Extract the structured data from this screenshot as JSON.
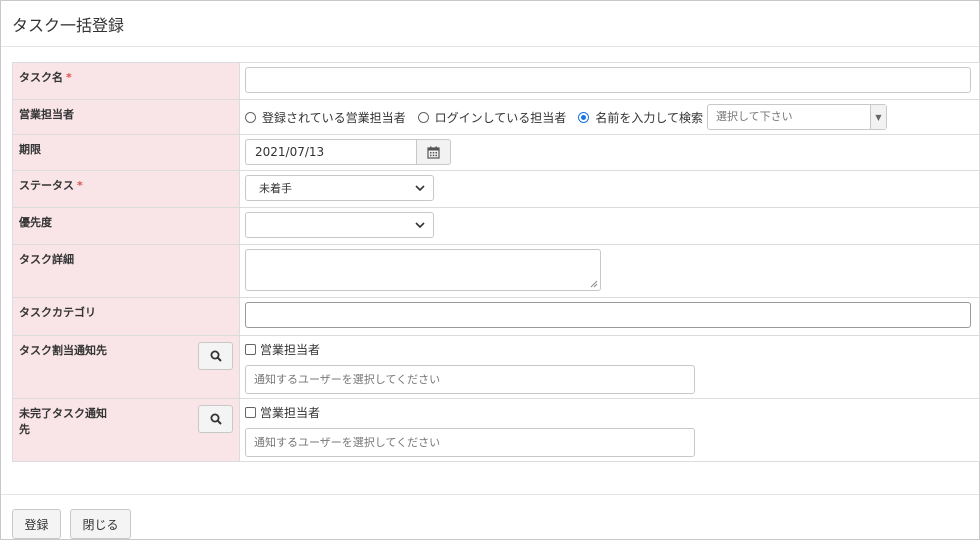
{
  "dialog": {
    "title": "タスク一括登録"
  },
  "fields": {
    "task_name": {
      "label": "タスク名",
      "required_mark": "*",
      "value": ""
    },
    "sales_owner": {
      "label": "営業担当者",
      "options": [
        {
          "label": "登録されている営業担当者",
          "selected": false
        },
        {
          "label": "ログインしている担当者",
          "selected": false
        },
        {
          "label": "名前を入力して検索",
          "selected": true
        }
      ],
      "search_placeholder": "選択して下さい",
      "dropdown_arrow": "▼"
    },
    "due_date": {
      "label": "期限",
      "value": "2021/07/13",
      "icon": "calendar-icon"
    },
    "status": {
      "label": "ステータス",
      "required_mark": "*",
      "value": "未着手"
    },
    "priority": {
      "label": "優先度",
      "value": ""
    },
    "task_detail": {
      "label": "タスク詳細",
      "value": ""
    },
    "task_category": {
      "label": "タスクカテゴリ",
      "value": ""
    },
    "assign_notify": {
      "label": "タスク割当通知先",
      "checkbox_label": "営業担当者",
      "checked": false,
      "placeholder": "通知するユーザーを選択してください",
      "icon": "search-icon"
    },
    "incomplete_notify": {
      "label_line1": "未完了タスク通知",
      "label_line2": "先",
      "checkbox_label": "営業担当者",
      "checked": false,
      "placeholder": "通知するユーザーを選択してください",
      "icon": "search-icon"
    }
  },
  "footer": {
    "register_label": "登録",
    "close_label": "閉じる"
  },
  "colors": {
    "label_bg": "#f9e5e8",
    "required": "#d9534f",
    "radio_on": "#1a73e8"
  }
}
